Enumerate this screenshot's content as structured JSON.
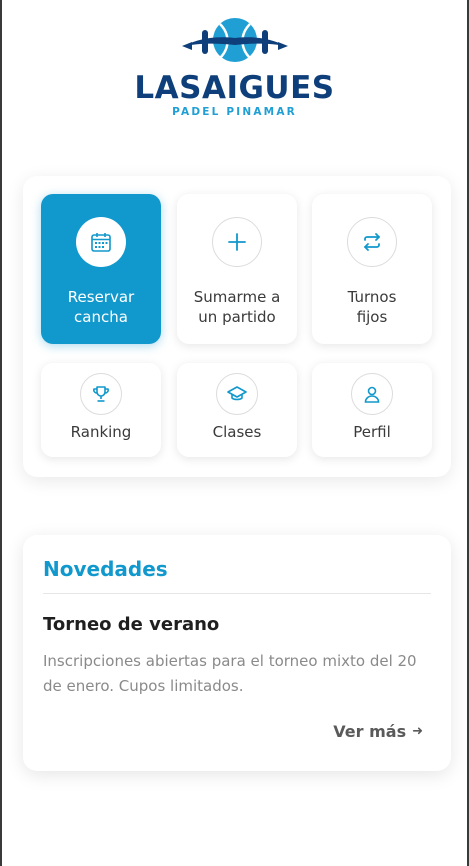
{
  "brand": {
    "name": "LASAIGUES",
    "tagline": "PADEL PINAMAR",
    "colors": {
      "navy": "#0e3f7a",
      "sky": "#1f9fd4",
      "accent": "#1198cc"
    }
  },
  "menu": {
    "items": [
      {
        "label": "Reservar\ncancha",
        "icon": "calendar-icon",
        "active": true
      },
      {
        "label": "Sumarme a\nun partido",
        "icon": "plus-icon",
        "active": false
      },
      {
        "label": "Turnos\nfijos",
        "icon": "repeat-icon",
        "active": false
      },
      {
        "label": "Ranking",
        "icon": "trophy-icon",
        "active": false
      },
      {
        "label": "Clases",
        "icon": "graduation-cap-icon",
        "active": false
      },
      {
        "label": "Perfil",
        "icon": "user-icon",
        "active": false
      }
    ]
  },
  "news": {
    "heading": "Novedades",
    "title": "Torneo de verano",
    "body": "Inscripciones abiertas para el torneo mixto del 20 de enero. Cupos limitados.",
    "more_label": "Ver más"
  }
}
